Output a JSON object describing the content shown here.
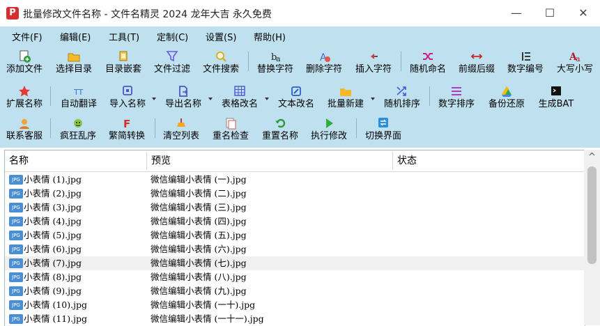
{
  "window": {
    "title": "批量修改文件名称 - 文件名精灵 2024 龙年大吉 永久免费",
    "app_icon_letter": "P",
    "minimize": "—",
    "maximize": "☐",
    "close": "✕"
  },
  "menu": [
    "文件(F)",
    "编辑(E)",
    "工具(T)",
    "定制(C)",
    "设置(S)",
    "帮助(H)"
  ],
  "toolbar_row1": [
    {
      "label": "添加文件",
      "icon": "add-file-icon"
    },
    {
      "label": "选择目录",
      "icon": "folder-open-icon"
    },
    {
      "label": "目录嵌套",
      "icon": "folder-nest-icon"
    },
    {
      "label": "文件过滤",
      "icon": "filter-icon"
    },
    {
      "label": "文件搜索",
      "icon": "search-icon"
    },
    {
      "label": "替换字符",
      "icon": "replace-icon"
    },
    {
      "label": "删除字符",
      "icon": "erase-icon"
    },
    {
      "label": "插入字符",
      "icon": "insert-icon"
    },
    {
      "label": "随机命名",
      "icon": "shuffle-icon"
    },
    {
      "label": "前缀后缀",
      "icon": "prefix-suffix-icon"
    },
    {
      "label": "数字编号",
      "icon": "numbered-list-icon"
    },
    {
      "label": "大写小写",
      "icon": "case-icon"
    }
  ],
  "toolbar_row2": [
    {
      "label": "扩展名称",
      "icon": "star-icon"
    },
    {
      "label": "自动翻译",
      "icon": "translate-icon"
    },
    {
      "label": "导入名称",
      "icon": "import-icon"
    },
    {
      "label": "导出名称",
      "icon": "export-icon"
    },
    {
      "label": "表格改名",
      "icon": "table-icon"
    },
    {
      "label": "文本改名",
      "icon": "edit-icon"
    },
    {
      "label": "批量新建",
      "icon": "new-folder-icon"
    },
    {
      "label": "随机排序",
      "icon": "random-sort-icon"
    },
    {
      "label": "数字排序",
      "icon": "number-sort-icon"
    },
    {
      "label": "备份还原",
      "icon": "backup-icon"
    },
    {
      "label": "生成BAT",
      "icon": "terminal-icon"
    }
  ],
  "toolbar_row3": [
    {
      "label": "联系客服",
      "icon": "support-icon"
    },
    {
      "label": "疯狂乱序",
      "icon": "crazy-icon"
    },
    {
      "label": "繁简转换",
      "icon": "convert-icon"
    },
    {
      "label": "清空列表",
      "icon": "clear-list-icon"
    },
    {
      "label": "重名检查",
      "icon": "duplicate-check-icon"
    },
    {
      "label": "重置名称",
      "icon": "reset-icon"
    },
    {
      "label": "执行修改",
      "icon": "run-icon"
    },
    {
      "label": "切换界面",
      "icon": "switch-icon"
    }
  ],
  "columns": [
    "名称",
    "预览",
    "状态"
  ],
  "file_icon_text": "JPG",
  "rows": [
    {
      "name": "小表情 (1).jpg",
      "preview": "微信编辑小表情 (一).jpg",
      "status": ""
    },
    {
      "name": "小表情 (2).jpg",
      "preview": "微信编辑小表情 (二).jpg",
      "status": ""
    },
    {
      "name": "小表情 (3).jpg",
      "preview": "微信编辑小表情 (三).jpg",
      "status": ""
    },
    {
      "name": "小表情 (4).jpg",
      "preview": "微信编辑小表情 (四).jpg",
      "status": ""
    },
    {
      "name": "小表情 (5).jpg",
      "preview": "微信编辑小表情 (五).jpg",
      "status": ""
    },
    {
      "name": "小表情 (6).jpg",
      "preview": "微信编辑小表情 (六).jpg",
      "status": ""
    },
    {
      "name": "小表情 (7).jpg",
      "preview": "微信编辑小表情 (七).jpg",
      "status": ""
    },
    {
      "name": "小表情 (8).jpg",
      "preview": "微信编辑小表情 (八).jpg",
      "status": ""
    },
    {
      "name": "小表情 (9).jpg",
      "preview": "微信编辑小表情 (九).jpg",
      "status": ""
    },
    {
      "name": "小表情 (10).jpg",
      "preview": "微信编辑小表情 (一十).jpg",
      "status": ""
    },
    {
      "name": "小表情 (11).jpg",
      "preview": "微信编辑小表情 (一十一).jpg",
      "status": ""
    }
  ],
  "selected_row_index": 6,
  "scroll_up": "^"
}
